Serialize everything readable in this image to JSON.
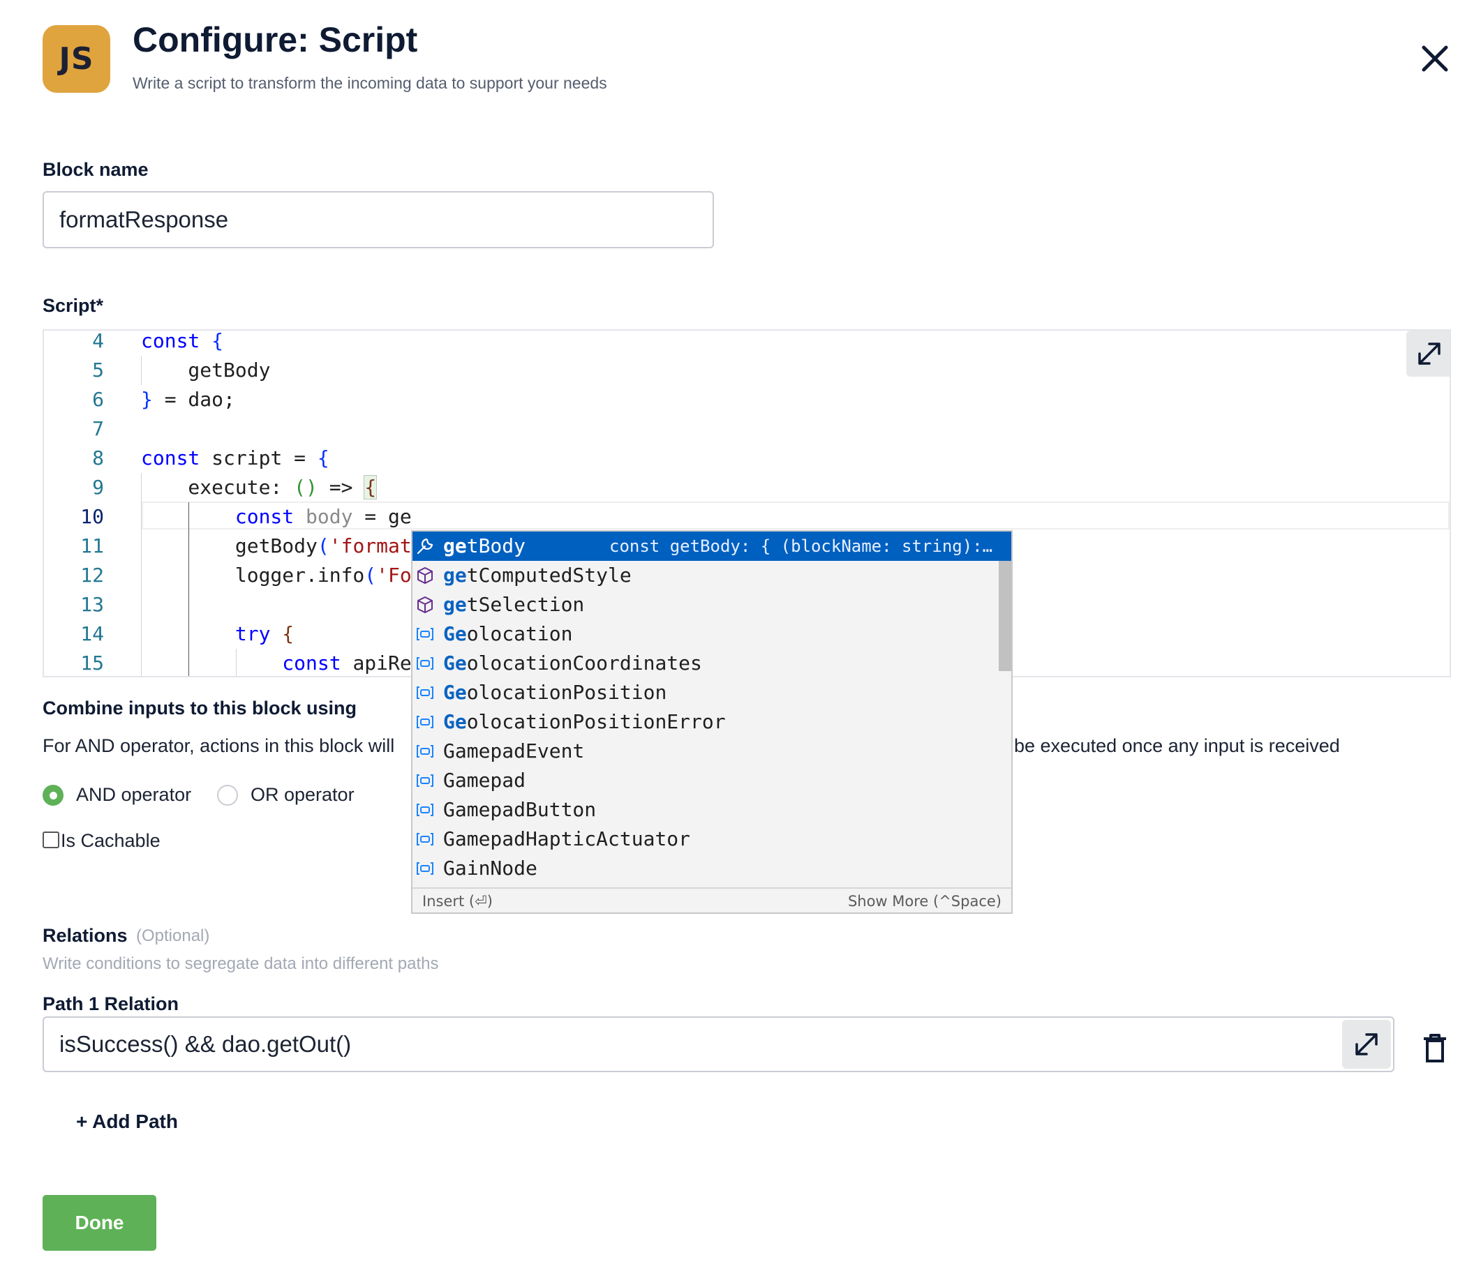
{
  "header": {
    "logo_text": "JS",
    "title": "Configure: Script",
    "subtitle": "Write a script to transform the incoming data to support your needs"
  },
  "block_name": {
    "label": "Block name",
    "value": "formatResponse"
  },
  "script": {
    "label": "Script*",
    "line_numbers": [
      "4",
      "5",
      "6",
      "7",
      "8",
      "9",
      "10",
      "11",
      "12",
      "13",
      "14",
      "15"
    ],
    "active_line": "10"
  },
  "autocomplete": {
    "items": [
      {
        "label": "getBody",
        "match": "ge",
        "rest": "tBody",
        "icon": "wrench-icon",
        "detail": "const getBody: { (blockName: string):…"
      },
      {
        "label": "getComputedStyle",
        "match": "ge",
        "rest": "tComputedStyle",
        "icon": "cube-icon"
      },
      {
        "label": "getSelection",
        "match": "ge",
        "rest": "tSelection",
        "icon": "cube-icon"
      },
      {
        "label": "Geolocation",
        "match": "Ge",
        "rest": "olocation",
        "icon": "variable-icon"
      },
      {
        "label": "GeolocationCoordinates",
        "match": "Ge",
        "rest": "olocationCoordinates",
        "icon": "variable-icon"
      },
      {
        "label": "GeolocationPosition",
        "match": "Ge",
        "rest": "olocationPosition",
        "icon": "variable-icon"
      },
      {
        "label": "GeolocationPositionError",
        "match": "Ge",
        "rest": "olocationPositionError",
        "icon": "variable-icon"
      },
      {
        "label": "GamepadEvent",
        "icon": "variable-icon"
      },
      {
        "label": "Gamepad",
        "icon": "variable-icon"
      },
      {
        "label": "GamepadButton",
        "icon": "variable-icon"
      },
      {
        "label": "GamepadHapticActuator",
        "icon": "variable-icon"
      },
      {
        "label": "GainNode",
        "icon": "variable-icon"
      }
    ],
    "footer_left": "Insert (⏎)",
    "footer_right": "Show More (^Space)"
  },
  "combine": {
    "label": "Combine inputs to this block using",
    "description_left": "For AND operator, actions in this block will",
    "description_right": "be executed once any input is received",
    "and_label": "AND operator",
    "or_label": "OR operator",
    "selected": "AND operator",
    "cachable_label": "Is Cachable"
  },
  "relations": {
    "label": "Relations",
    "optional": "(Optional)",
    "description": "Write conditions to segregate data into different paths",
    "path_label": "Path 1 Relation",
    "path_value": "isSuccess() && dao.getOut()",
    "add_path": "+ Add Path"
  },
  "done_label": "Done",
  "colors": {
    "accent_green": "#5fb157",
    "logo_bg": "#e0a43f",
    "suggest_selected": "#0060c0"
  }
}
